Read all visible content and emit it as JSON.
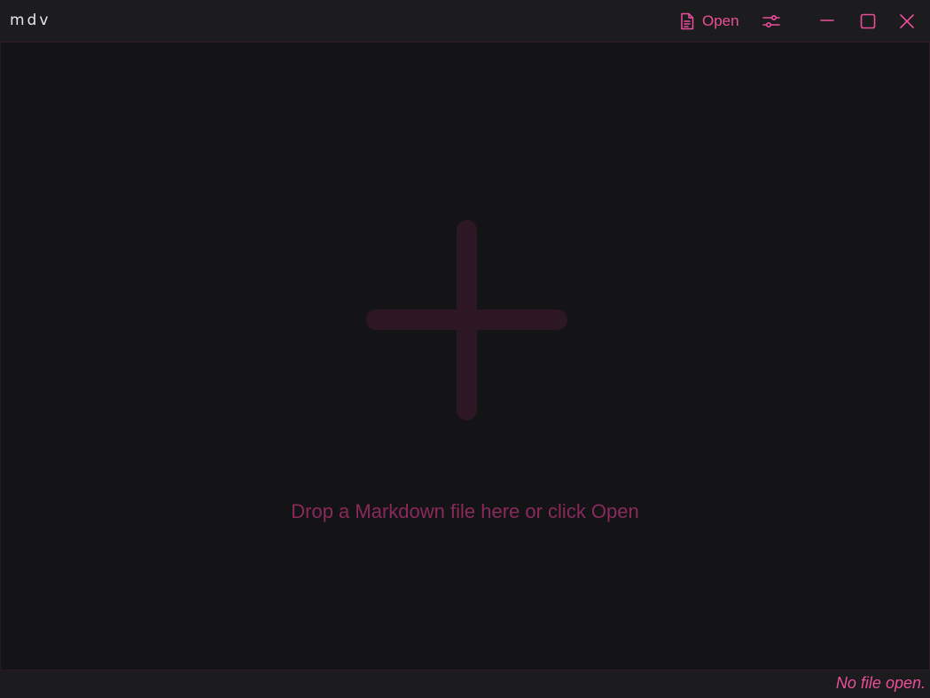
{
  "app": {
    "title": "mdv"
  },
  "toolbar": {
    "open_label": "Open",
    "open_icon": "file-text-icon",
    "settings_icon": "sliders-icon"
  },
  "window_controls": {
    "minimize_icon": "minimize-icon",
    "maximize_icon": "maximize-icon",
    "close_icon": "close-icon"
  },
  "drop_zone": {
    "icon": "plus-icon",
    "hint": "Drop a Markdown file here or click Open"
  },
  "status": {
    "text": "No file open."
  },
  "colors": {
    "accent": "#ec4f9a",
    "muted_accent": "#8a2a5b",
    "plus": "#2e1724",
    "background": "#141316",
    "titlebar": "#1c1c1e",
    "window_controls": "#ec4f9a",
    "app_title": "#e6e6ea"
  }
}
